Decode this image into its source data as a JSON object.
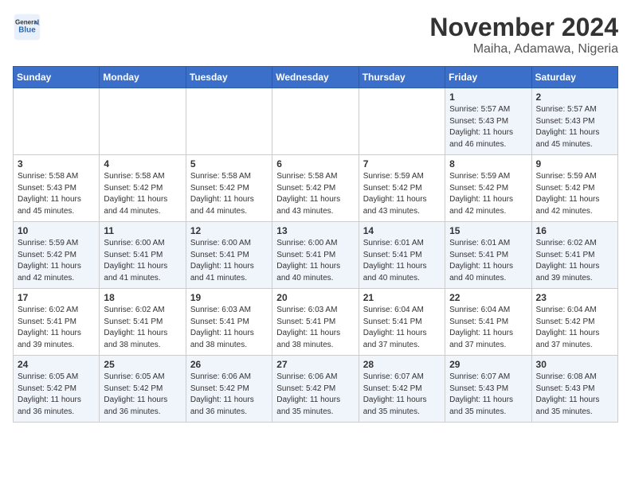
{
  "header": {
    "logo_line1": "General",
    "logo_line2": "Blue",
    "month": "November 2024",
    "location": "Maiha, Adamawa, Nigeria"
  },
  "weekdays": [
    "Sunday",
    "Monday",
    "Tuesday",
    "Wednesday",
    "Thursday",
    "Friday",
    "Saturday"
  ],
  "weeks": [
    [
      {
        "day": "",
        "info": ""
      },
      {
        "day": "",
        "info": ""
      },
      {
        "day": "",
        "info": ""
      },
      {
        "day": "",
        "info": ""
      },
      {
        "day": "",
        "info": ""
      },
      {
        "day": "1",
        "info": "Sunrise: 5:57 AM\nSunset: 5:43 PM\nDaylight: 11 hours\nand 46 minutes."
      },
      {
        "day": "2",
        "info": "Sunrise: 5:57 AM\nSunset: 5:43 PM\nDaylight: 11 hours\nand 45 minutes."
      }
    ],
    [
      {
        "day": "3",
        "info": "Sunrise: 5:58 AM\nSunset: 5:43 PM\nDaylight: 11 hours\nand 45 minutes."
      },
      {
        "day": "4",
        "info": "Sunrise: 5:58 AM\nSunset: 5:42 PM\nDaylight: 11 hours\nand 44 minutes."
      },
      {
        "day": "5",
        "info": "Sunrise: 5:58 AM\nSunset: 5:42 PM\nDaylight: 11 hours\nand 44 minutes."
      },
      {
        "day": "6",
        "info": "Sunrise: 5:58 AM\nSunset: 5:42 PM\nDaylight: 11 hours\nand 43 minutes."
      },
      {
        "day": "7",
        "info": "Sunrise: 5:59 AM\nSunset: 5:42 PM\nDaylight: 11 hours\nand 43 minutes."
      },
      {
        "day": "8",
        "info": "Sunrise: 5:59 AM\nSunset: 5:42 PM\nDaylight: 11 hours\nand 42 minutes."
      },
      {
        "day": "9",
        "info": "Sunrise: 5:59 AM\nSunset: 5:42 PM\nDaylight: 11 hours\nand 42 minutes."
      }
    ],
    [
      {
        "day": "10",
        "info": "Sunrise: 5:59 AM\nSunset: 5:42 PM\nDaylight: 11 hours\nand 42 minutes."
      },
      {
        "day": "11",
        "info": "Sunrise: 6:00 AM\nSunset: 5:41 PM\nDaylight: 11 hours\nand 41 minutes."
      },
      {
        "day": "12",
        "info": "Sunrise: 6:00 AM\nSunset: 5:41 PM\nDaylight: 11 hours\nand 41 minutes."
      },
      {
        "day": "13",
        "info": "Sunrise: 6:00 AM\nSunset: 5:41 PM\nDaylight: 11 hours\nand 40 minutes."
      },
      {
        "day": "14",
        "info": "Sunrise: 6:01 AM\nSunset: 5:41 PM\nDaylight: 11 hours\nand 40 minutes."
      },
      {
        "day": "15",
        "info": "Sunrise: 6:01 AM\nSunset: 5:41 PM\nDaylight: 11 hours\nand 40 minutes."
      },
      {
        "day": "16",
        "info": "Sunrise: 6:02 AM\nSunset: 5:41 PM\nDaylight: 11 hours\nand 39 minutes."
      }
    ],
    [
      {
        "day": "17",
        "info": "Sunrise: 6:02 AM\nSunset: 5:41 PM\nDaylight: 11 hours\nand 39 minutes."
      },
      {
        "day": "18",
        "info": "Sunrise: 6:02 AM\nSunset: 5:41 PM\nDaylight: 11 hours\nand 38 minutes."
      },
      {
        "day": "19",
        "info": "Sunrise: 6:03 AM\nSunset: 5:41 PM\nDaylight: 11 hours\nand 38 minutes."
      },
      {
        "day": "20",
        "info": "Sunrise: 6:03 AM\nSunset: 5:41 PM\nDaylight: 11 hours\nand 38 minutes."
      },
      {
        "day": "21",
        "info": "Sunrise: 6:04 AM\nSunset: 5:41 PM\nDaylight: 11 hours\nand 37 minutes."
      },
      {
        "day": "22",
        "info": "Sunrise: 6:04 AM\nSunset: 5:41 PM\nDaylight: 11 hours\nand 37 minutes."
      },
      {
        "day": "23",
        "info": "Sunrise: 6:04 AM\nSunset: 5:42 PM\nDaylight: 11 hours\nand 37 minutes."
      }
    ],
    [
      {
        "day": "24",
        "info": "Sunrise: 6:05 AM\nSunset: 5:42 PM\nDaylight: 11 hours\nand 36 minutes."
      },
      {
        "day": "25",
        "info": "Sunrise: 6:05 AM\nSunset: 5:42 PM\nDaylight: 11 hours\nand 36 minutes."
      },
      {
        "day": "26",
        "info": "Sunrise: 6:06 AM\nSunset: 5:42 PM\nDaylight: 11 hours\nand 36 minutes."
      },
      {
        "day": "27",
        "info": "Sunrise: 6:06 AM\nSunset: 5:42 PM\nDaylight: 11 hours\nand 35 minutes."
      },
      {
        "day": "28",
        "info": "Sunrise: 6:07 AM\nSunset: 5:42 PM\nDaylight: 11 hours\nand 35 minutes."
      },
      {
        "day": "29",
        "info": "Sunrise: 6:07 AM\nSunset: 5:43 PM\nDaylight: 11 hours\nand 35 minutes."
      },
      {
        "day": "30",
        "info": "Sunrise: 6:08 AM\nSunset: 5:43 PM\nDaylight: 11 hours\nand 35 minutes."
      }
    ]
  ]
}
